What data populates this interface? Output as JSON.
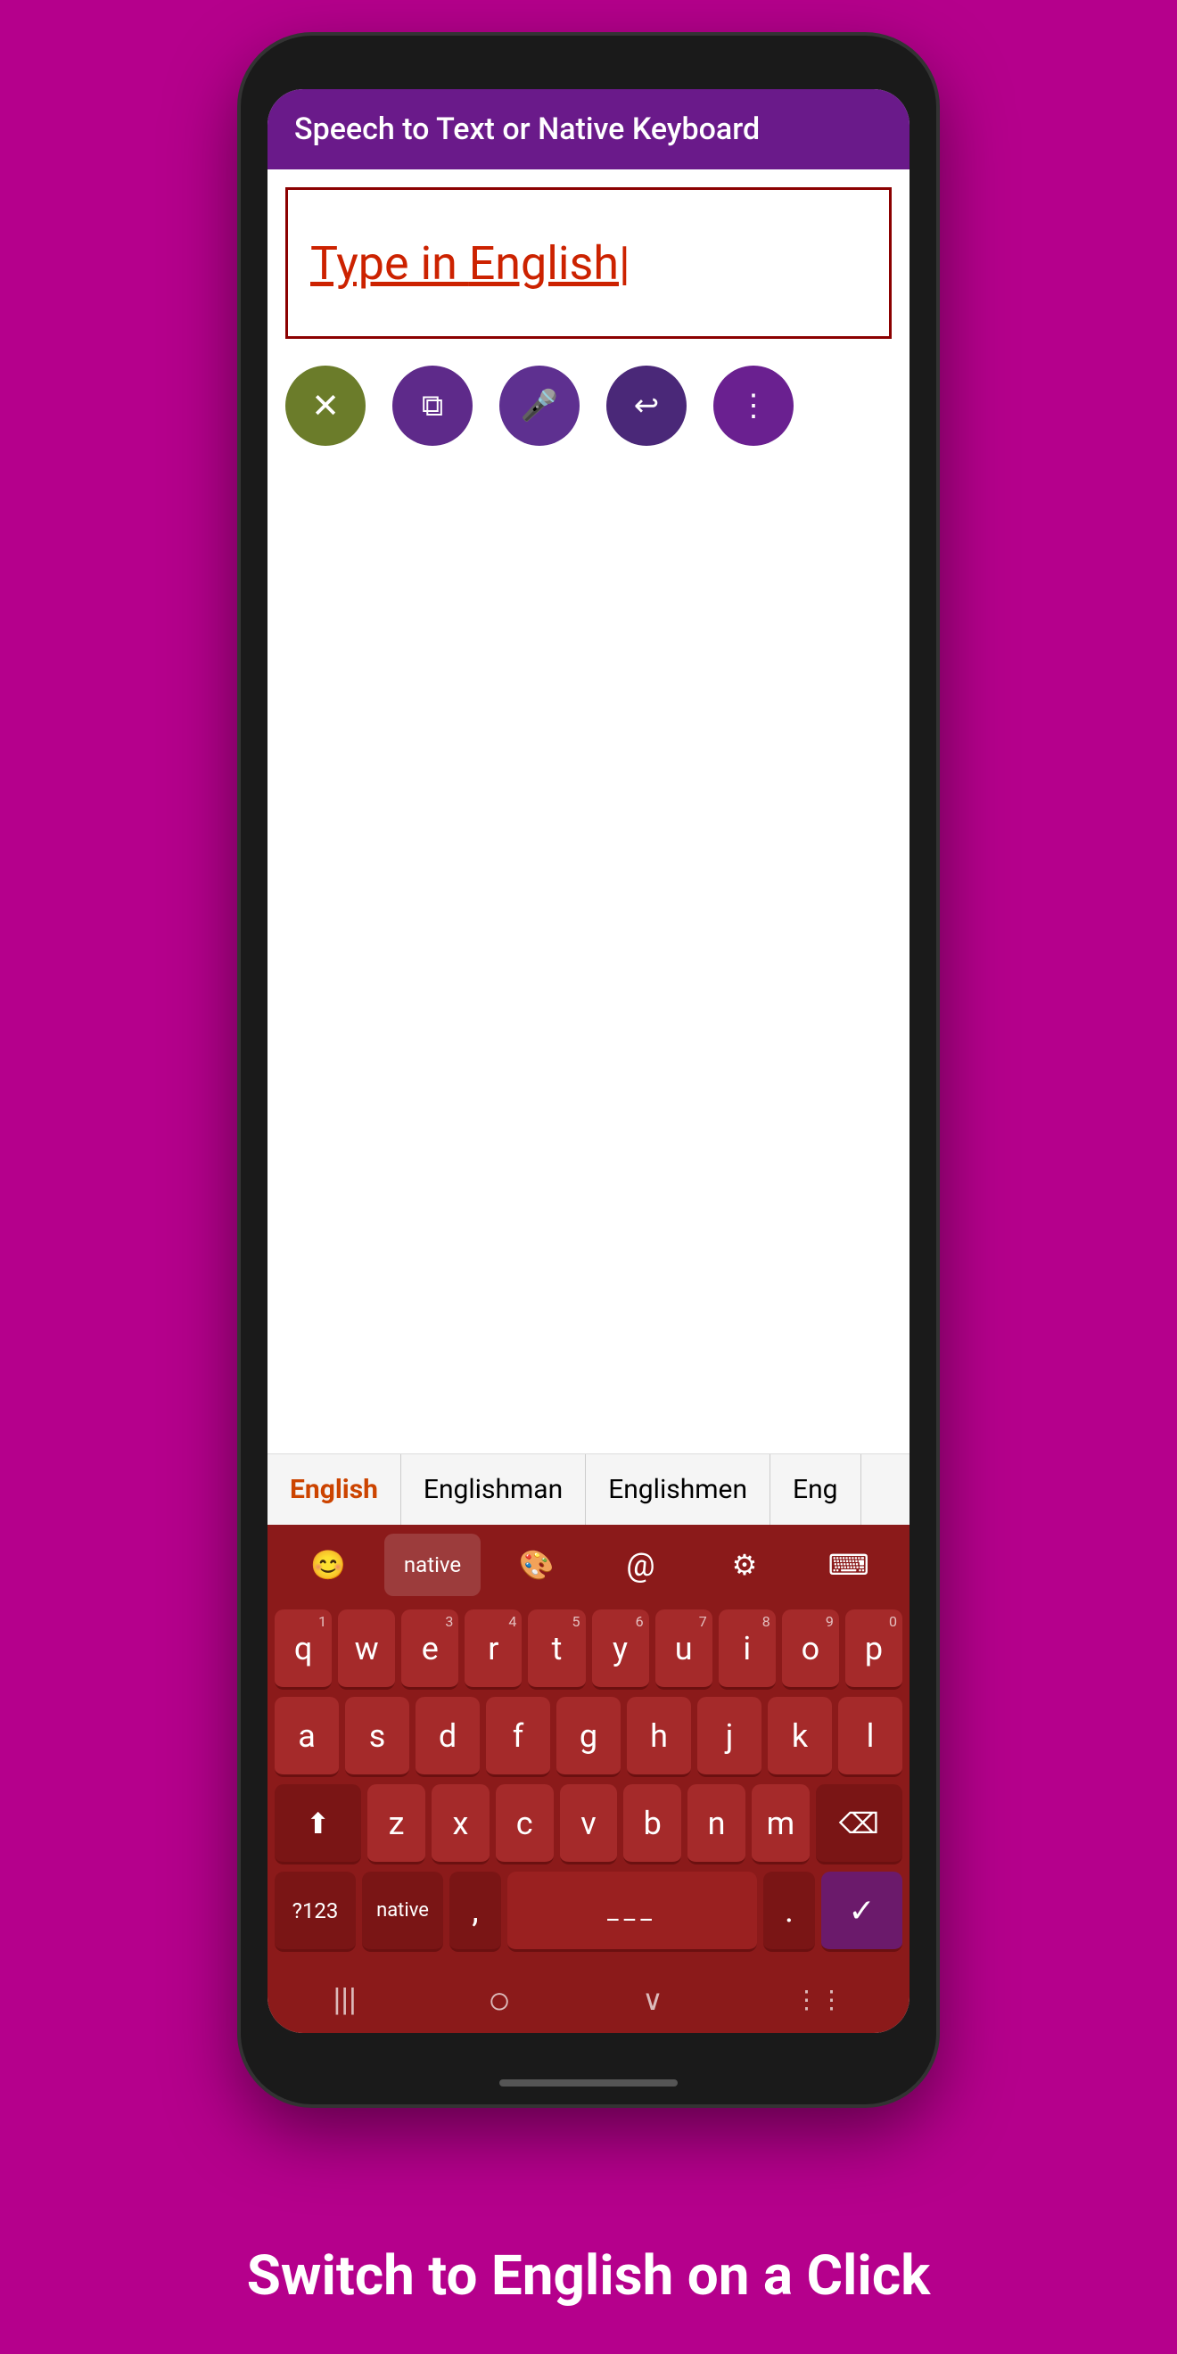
{
  "page": {
    "background_color": "#b5008c",
    "bottom_text": "Switch to English on a Click"
  },
  "phone": {
    "top_bar_title": "Speech to Text or Native Keyboard"
  },
  "input_area": {
    "prompt_prefix": "Type in ",
    "prompt_language": "English"
  },
  "action_buttons": [
    {
      "name": "delete",
      "icon": "✕",
      "color": "#6b7c2a",
      "label": "delete-button"
    },
    {
      "name": "copy",
      "icon": "⧉",
      "color": "#5e2a8a",
      "label": "copy-button"
    },
    {
      "name": "mic",
      "icon": "🎤",
      "color": "#5e3090",
      "label": "mic-button"
    },
    {
      "name": "undo",
      "icon": "↩",
      "color": "#4a2878",
      "label": "undo-button"
    },
    {
      "name": "share",
      "icon": "⋮",
      "color": "#6a2090",
      "label": "share-button"
    }
  ],
  "suggestions": [
    {
      "text": "English",
      "active": true
    },
    {
      "text": "Englishman",
      "active": false
    },
    {
      "text": "Englishmen",
      "active": false
    },
    {
      "text": "Eng",
      "active": false
    }
  ],
  "toolbar": [
    {
      "label": "😊",
      "type": "emoji"
    },
    {
      "label": "native",
      "type": "native"
    },
    {
      "label": "🎨",
      "type": "palette"
    },
    {
      "label": "@",
      "type": "at"
    },
    {
      "label": "⚙",
      "type": "settings"
    },
    {
      "label": "⌨",
      "type": "keyboard"
    }
  ],
  "keyboard": {
    "rows": [
      [
        {
          "key": "q",
          "num": "1"
        },
        {
          "key": "w",
          "num": ""
        },
        {
          "key": "e",
          "num": "3"
        },
        {
          "key": "r",
          "num": "4"
        },
        {
          "key": "t",
          "num": "5"
        },
        {
          "key": "y",
          "num": "6"
        },
        {
          "key": "u",
          "num": "7"
        },
        {
          "key": "i",
          "num": "8"
        },
        {
          "key": "o",
          "num": "9"
        },
        {
          "key": "p",
          "num": "0"
        }
      ],
      [
        {
          "key": "a"
        },
        {
          "key": "s"
        },
        {
          "key": "d"
        },
        {
          "key": "f"
        },
        {
          "key": "g"
        },
        {
          "key": "h"
        },
        {
          "key": "j"
        },
        {
          "key": "k"
        },
        {
          "key": "l"
        }
      ]
    ],
    "row3": [
      "z",
      "x",
      "c",
      "v",
      "b",
      "n",
      "m"
    ],
    "bottom_left": "?123",
    "bottom_native": "native",
    "bottom_comma": ",",
    "bottom_space": "___",
    "bottom_period": ".",
    "shift_icon": "⬆",
    "delete_icon": "⌫",
    "confirm_icon": "✓"
  },
  "bottom_nav": {
    "back_icon": "|||",
    "home_icon": "○",
    "down_icon": "∨",
    "grid_icon": "⋮⋮"
  }
}
